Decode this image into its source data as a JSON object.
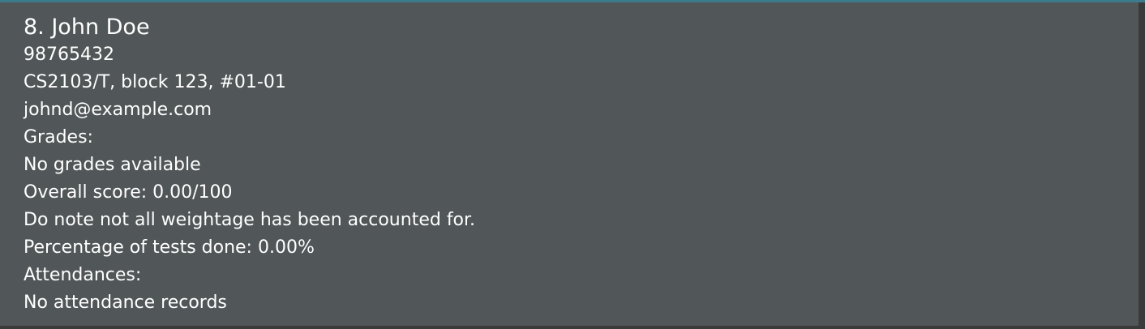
{
  "person": {
    "index_name": "8. John Doe",
    "phone": "98765432",
    "address": "CS2103/T, block 123, #01-01",
    "email": "johnd@example.com",
    "grades_header": "Grades:",
    "grades_status": "No grades available",
    "overall_score": "Overall score: 0.00/100",
    "weightage_note": "Do note not all weightage has been accounted for.",
    "tests_done": "Percentage of tests done: 0.00%",
    "attendances_header": "Attendances:",
    "attendance_status": "No attendance records"
  },
  "colors": {
    "card_background": "#515658",
    "accent": "#3d7a8c",
    "text": "#ffffff",
    "gutter": "#3a3a3a"
  }
}
